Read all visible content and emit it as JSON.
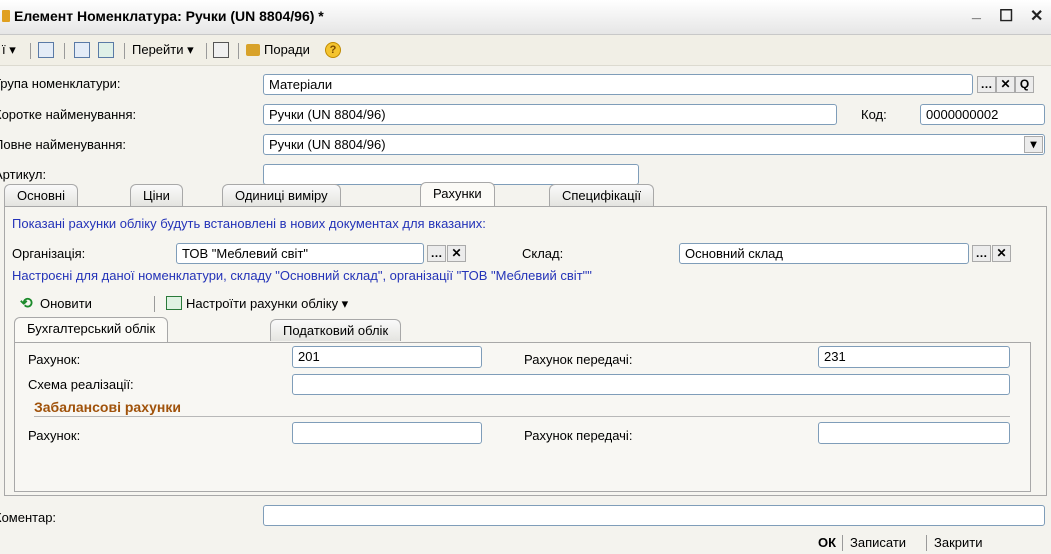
{
  "window": {
    "title": "Елемент Номенклатура: Ручки (UN 8804/96) *",
    "minimize_glyph": "_",
    "maximize_glyph": "☐",
    "close_glyph": "✕"
  },
  "toolbar": {
    "actions_label": "ї ▾",
    "goto_label": "Перейти ▾",
    "tips_label": "Поради"
  },
  "form": {
    "group_label": "Група номенклатури:",
    "group_value": "Матеріали",
    "short_name_label": "Коротке найменування:",
    "short_name_value": "Ручки (UN 8804/96)",
    "code_label": "Код:",
    "code_value": "0000000002",
    "full_name_label": "Повне найменування:",
    "full_name_value": "Ручки (UN 8804/96)",
    "article_label": "Артикул:",
    "article_value": ""
  },
  "tabs": [
    {
      "label": "Основні"
    },
    {
      "label": "Ціни"
    },
    {
      "label": "Одиниці виміру"
    },
    {
      "label": "Рахунки"
    },
    {
      "label": "Специфікації"
    }
  ],
  "accounts": {
    "info_text": "Показані рахунки обліку будуть встановлені в нових документах для вказаних:",
    "org_label": "Організація:",
    "org_value": "ТОВ \"Меблевий світ\"",
    "warehouse_label": "Склад:",
    "warehouse_value": "Основний склад",
    "configured_text": "Настроєні для даної номенклатури, складу \"Основний склад\", організації \"ТОВ \"Меблевий світ\"\"",
    "refresh_label": "Оновити",
    "setup_label": "Настроїти рахунки обліку ▾",
    "subtabs": [
      {
        "label": "Бухгалтерський облік"
      },
      {
        "label": "Податковий облік"
      }
    ],
    "account_label": "Рахунок:",
    "account_value": "201",
    "transfer_label": "Рахунок передачі:",
    "transfer_value": "231",
    "scheme_label": "Схема реалізації:",
    "scheme_value": "",
    "offbalance_title": "Забалансові рахунки",
    "ob_account_label": "Рахунок:",
    "ob_account_value": "",
    "ob_transfer_label": "Рахунок передачі:",
    "ob_transfer_value": ""
  },
  "comment": {
    "label": "Коментар:",
    "value": ""
  },
  "footer": {
    "ok_label": "ОК",
    "save_label": "Записати",
    "close_label": "Закрити"
  }
}
